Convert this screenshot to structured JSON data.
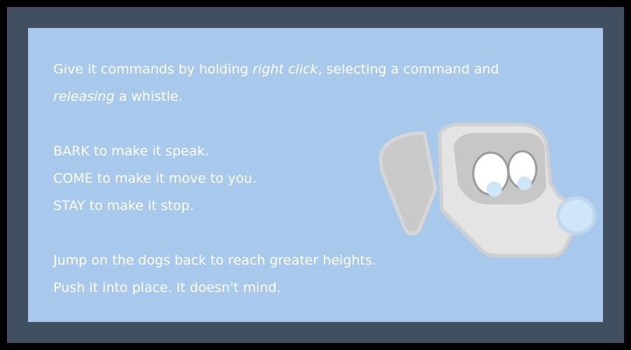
{
  "instructions": {
    "line1_pre": "Give it commands by holding ",
    "line1_em": "right click",
    "line1_post": ", selecting a command and",
    "line2_em": "releasing",
    "line2_post": " a whistle.",
    "bark_keyword": "BARK",
    "bark_text": " to make it speak.",
    "come_keyword": "COME",
    "come_text": " to make it move to you.",
    "stay_keyword": "STAY",
    "stay_text": " to make it stop.",
    "jump_text": "Jump on the dogs back to reach greater heights.",
    "push_text": "Push it into place. It doesn't mind."
  },
  "colors": {
    "outer_frame": "#415060",
    "panel_background": "#a8c8ec",
    "text": "#ffffff"
  },
  "icons": {
    "dog": "dog-head-icon"
  }
}
